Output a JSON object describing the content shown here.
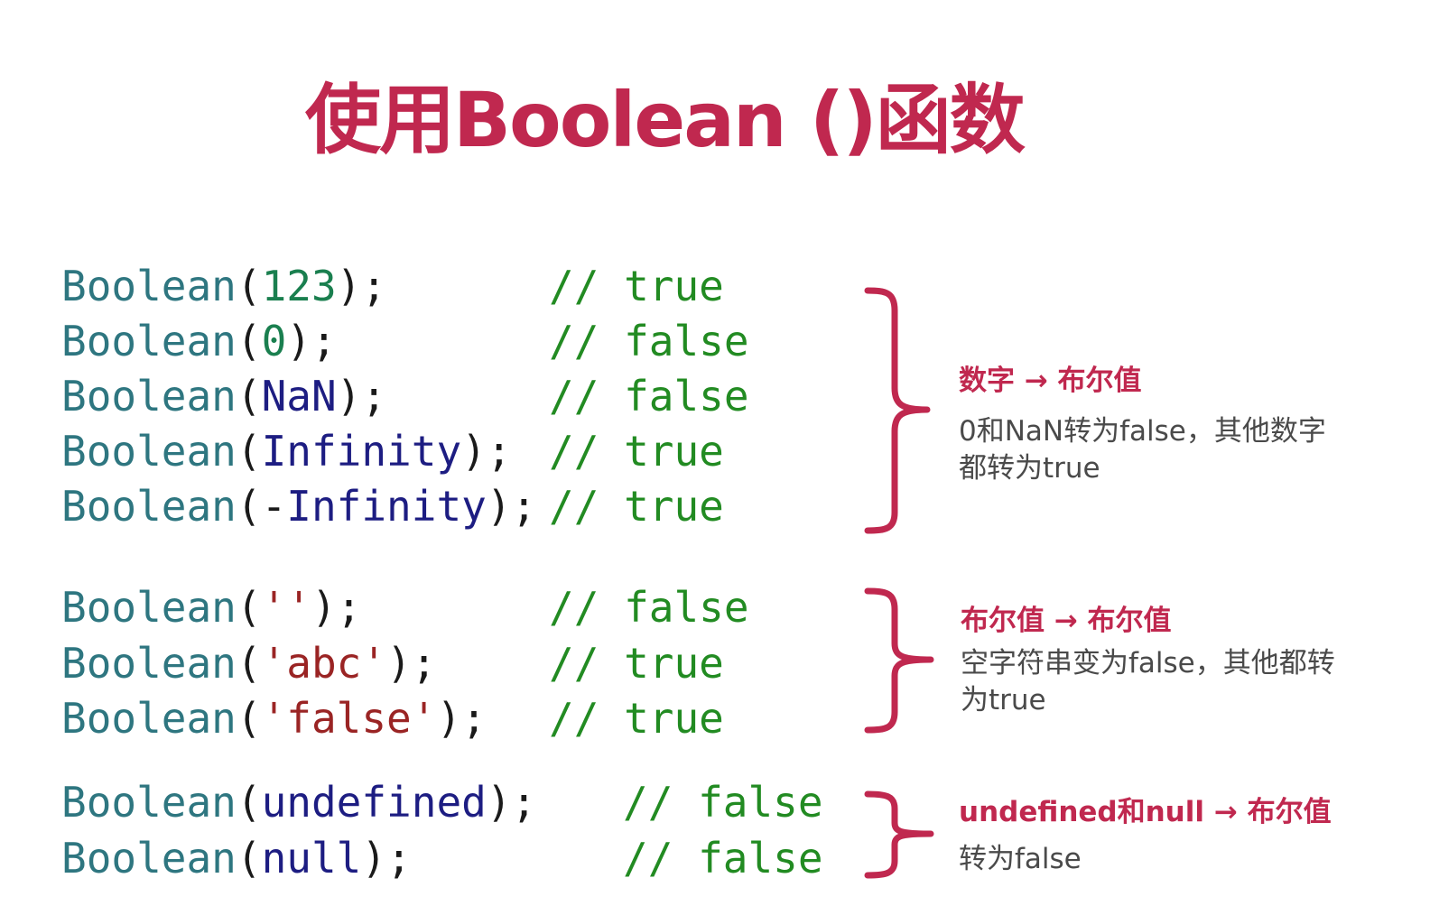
{
  "title": "使用Boolean ()函数",
  "code": [
    {
      "fn": "Boolean",
      "open": "(",
      "arg": "123",
      "close": ");",
      "comment": "// true"
    },
    {
      "fn": "Boolean",
      "open": "(",
      "arg": "0",
      "close": ");",
      "comment": "// false"
    },
    {
      "fn": "Boolean",
      "open": "(",
      "arg": "NaN",
      "close": ");",
      "comment": "// false"
    },
    {
      "fn": "Boolean",
      "open": "(",
      "arg": "Infinity",
      "close": ");",
      "comment": "// true"
    },
    {
      "fn": "Boolean",
      "open": "(",
      "arg_pre": "-",
      "arg": "Infinity",
      "close": ");",
      "comment": "// true"
    },
    {
      "fn": "Boolean",
      "open": "(",
      "arg": "''",
      "close": ");",
      "comment": "// false"
    },
    {
      "fn": "Boolean",
      "open": "(",
      "arg": "'abc'",
      "close": ");",
      "comment": "// true"
    },
    {
      "fn": "Boolean",
      "open": "(",
      "arg": "'false'",
      "close": ");",
      "comment": "// true"
    },
    {
      "fn": "Boolean",
      "open": "(",
      "arg": "undefined",
      "close": ");",
      "comment": "// false"
    },
    {
      "fn": "Boolean",
      "open": "(",
      "arg": "null",
      "close": ");",
      "comment": "// false"
    }
  ],
  "notes": [
    {
      "head": "数字 → 布尔值",
      "body": "0和NaN转为false，其他数字\n都转为true"
    },
    {
      "head": "布尔值 → 布尔值",
      "body": "空字符串变为false，其他都转\n为true"
    },
    {
      "head": "undefined和null → 布尔值",
      "body": "转为false"
    }
  ],
  "colors": {
    "accent": "#c0284f",
    "function": "#2e7680",
    "number": "#1a7f4f",
    "keyword": "#1d1d82",
    "string": "#9a2424",
    "comment": "#228b22"
  }
}
